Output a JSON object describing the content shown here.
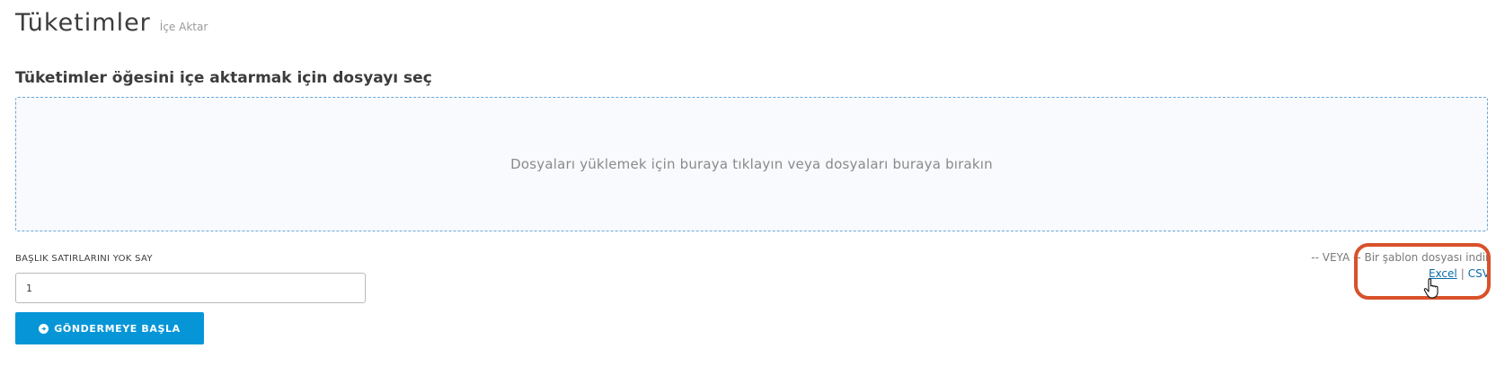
{
  "header": {
    "title": "Tüketimler",
    "subtitle": "İçe Aktar"
  },
  "import": {
    "heading": "Tüketimler öğesini içe aktarmak için dosyayı seç",
    "dropzone_text": "Dosyaları yüklemek için buraya tıklayın veya dosyaları buraya bırakın"
  },
  "skip_header": {
    "label": "BAŞLIK SATIRLARINI YOK SAY",
    "value": "1"
  },
  "submit": {
    "label": "GÖNDERMEYE BAŞLA",
    "icon": "arrow-circle-icon"
  },
  "template": {
    "or_text": "-- VEYA --",
    "download_text": "Bir şablon dosyası indir",
    "excel_label": "Excel",
    "separator": "|",
    "csv_label": "CSV"
  },
  "colors": {
    "accent": "#0696d7",
    "highlight": "#d8512a",
    "link": "#0a6aa8"
  }
}
